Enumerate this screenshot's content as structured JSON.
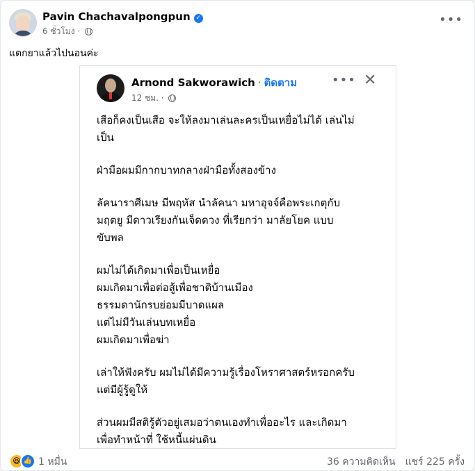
{
  "post": {
    "author": "Pavin Chachavalpongpun",
    "time": "6 ชั่วโมง ·",
    "caption": "แตกยาแล้วไปนอนค่ะ"
  },
  "shared": {
    "author": "Arnond Sakworawich",
    "dot": "·",
    "follow": "ติดตาม",
    "time": "12 ชม. ·",
    "paragraphs": [
      "เสือก็คงเป็นเสือ จะให้ลงมาเล่นละครเป็นเหยื่อไม่ได้ เล่นไม่\nเป็น",
      "ฝ่ามือผมมีกากบาทกลางฝ่ามือทั้งสองข้าง",
      "ลัคนาราศีเมษ มีพฤหัส นำลัคนา มหาอุจจ์คือพระเกตุกับ\nมฤตยู มีดาวเรียงกันเจ็ดดวง ที่เรียกว่า มาลัยโยค แบบ\nขับพล",
      "ผมไม่ได้เกิดมาเพื่อเป็นเหยื่อ\nผมเกิดมาเพื่อต่อสู้เพื่อชาติบ้านเมือง\nธรรมดานักรบย่อมมีบาดแผล\nแต่ไม่มีวันเล่นบทเหยื่อ\nผมเกิดมาเพื่อฆ่า",
      "เล่าให้ฟังครับ ผมไม่ได้มีความรู้เรื่องโหราศาสตร์หรอกครับ\nแต่มีผู้รู้ดูให้",
      "ส่วนผมมีสติรู้ตัวอยู่เสมอว่าตนเองทำเพื่ออะไร และเกิดมา\nเพื่อทำหน้าที่ ใช้หนี้แผ่นดิน"
    ]
  },
  "footer": {
    "reactions": "1 หมื่น",
    "comments": "36 ความคิดเห็น",
    "shares": "แชร์ 225 ครั้ง"
  },
  "icons": {
    "verified": "verified-badge-icon",
    "globe": "globe-icon",
    "more": "more-options-icon",
    "close": "close-icon",
    "haha": "haha-reaction-icon",
    "like": "like-reaction-icon"
  },
  "colors": {
    "accent": "#1877f2",
    "muted": "#65676b"
  }
}
